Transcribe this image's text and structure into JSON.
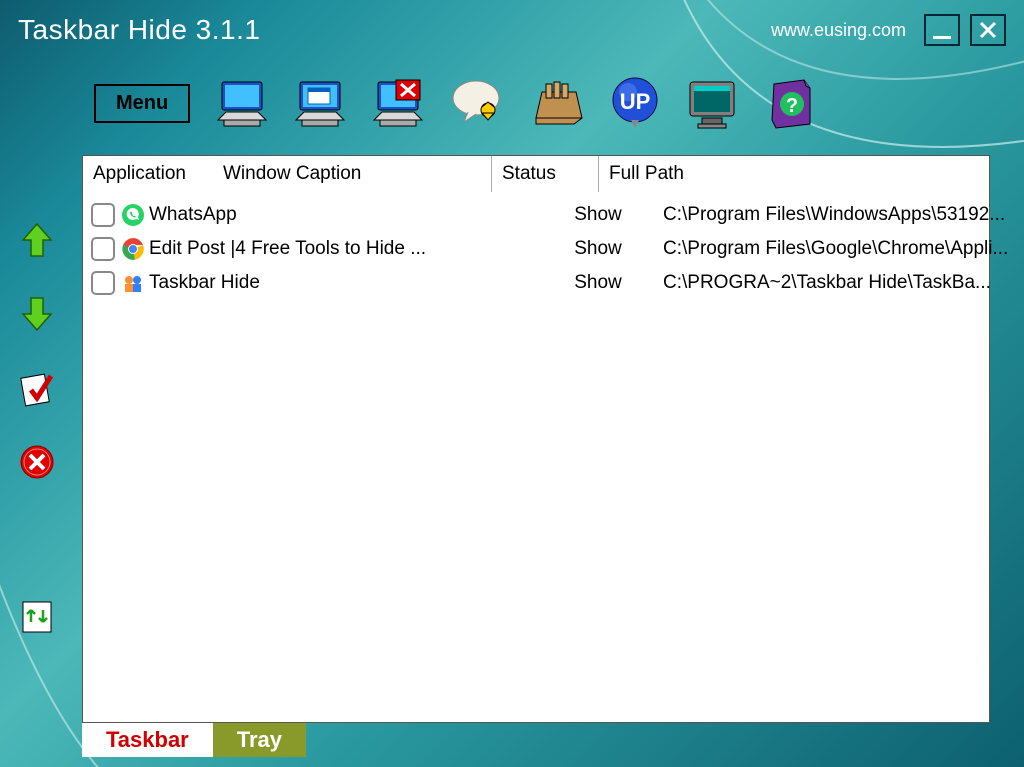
{
  "title": "Taskbar Hide 3.1.1",
  "url": "www.eusing.com",
  "menu_label": "Menu",
  "columns": {
    "application": "Application",
    "caption": "Window Caption",
    "status": "Status",
    "path": "Full Path"
  },
  "rows": [
    {
      "icon": "whatsapp",
      "caption": "WhatsApp",
      "status": "Show",
      "path": "C:\\Program Files\\WindowsApps\\53192..."
    },
    {
      "icon": "chrome",
      "caption": "Edit Post |4 Free Tools to Hide ...",
      "status": "Show",
      "path": "C:\\Program Files\\Google\\Chrome\\Appli..."
    },
    {
      "icon": "taskbar",
      "caption": "Taskbar Hide",
      "status": "Show",
      "path": "C:\\PROGRA~2\\Taskbar Hide\\TaskBa..."
    }
  ],
  "tabs": {
    "taskbar": "Taskbar",
    "tray": "Tray"
  }
}
